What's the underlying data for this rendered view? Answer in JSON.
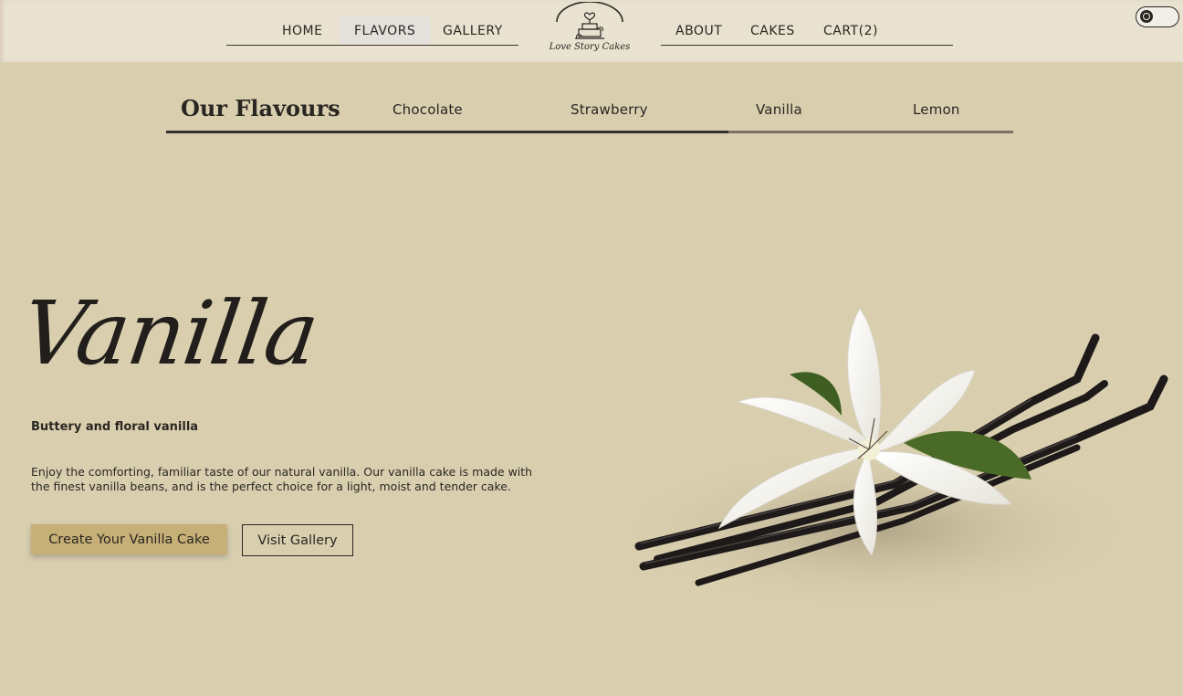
{
  "nav": {
    "left": [
      "HOME",
      "FLAVORS",
      "GALLERY"
    ],
    "right": [
      "ABOUT",
      "CAKES",
      "CART(2)"
    ],
    "active": "FLAVORS"
  },
  "logo": {
    "text": "Love Story Cakes",
    "icon": "cake-heart-logo-icon"
  },
  "theme_toggle": {
    "icon": "theme-toggle-icon"
  },
  "flavours": {
    "title": "Our Flavours",
    "tabs": [
      "Chocolate",
      "Strawberry",
      "Vanilla",
      "Lemon"
    ],
    "selected": "Vanilla"
  },
  "hero": {
    "title": "Vanilla",
    "tagline": "Buttery and floral vanilla",
    "description": "Enjoy the comforting, familiar taste of our natural vanilla. Our vanilla cake is made with the finest vanilla beans, and is the perfect choice for a light, moist and tender cake.",
    "primary_button": "Create Your Vanilla Cake",
    "secondary_button": "Visit Gallery"
  },
  "colors": {
    "page_bg": "#d9cfaf",
    "header_bg": "#e9e2d0",
    "primary_button": "#c7b077",
    "text": "#2a2622"
  }
}
